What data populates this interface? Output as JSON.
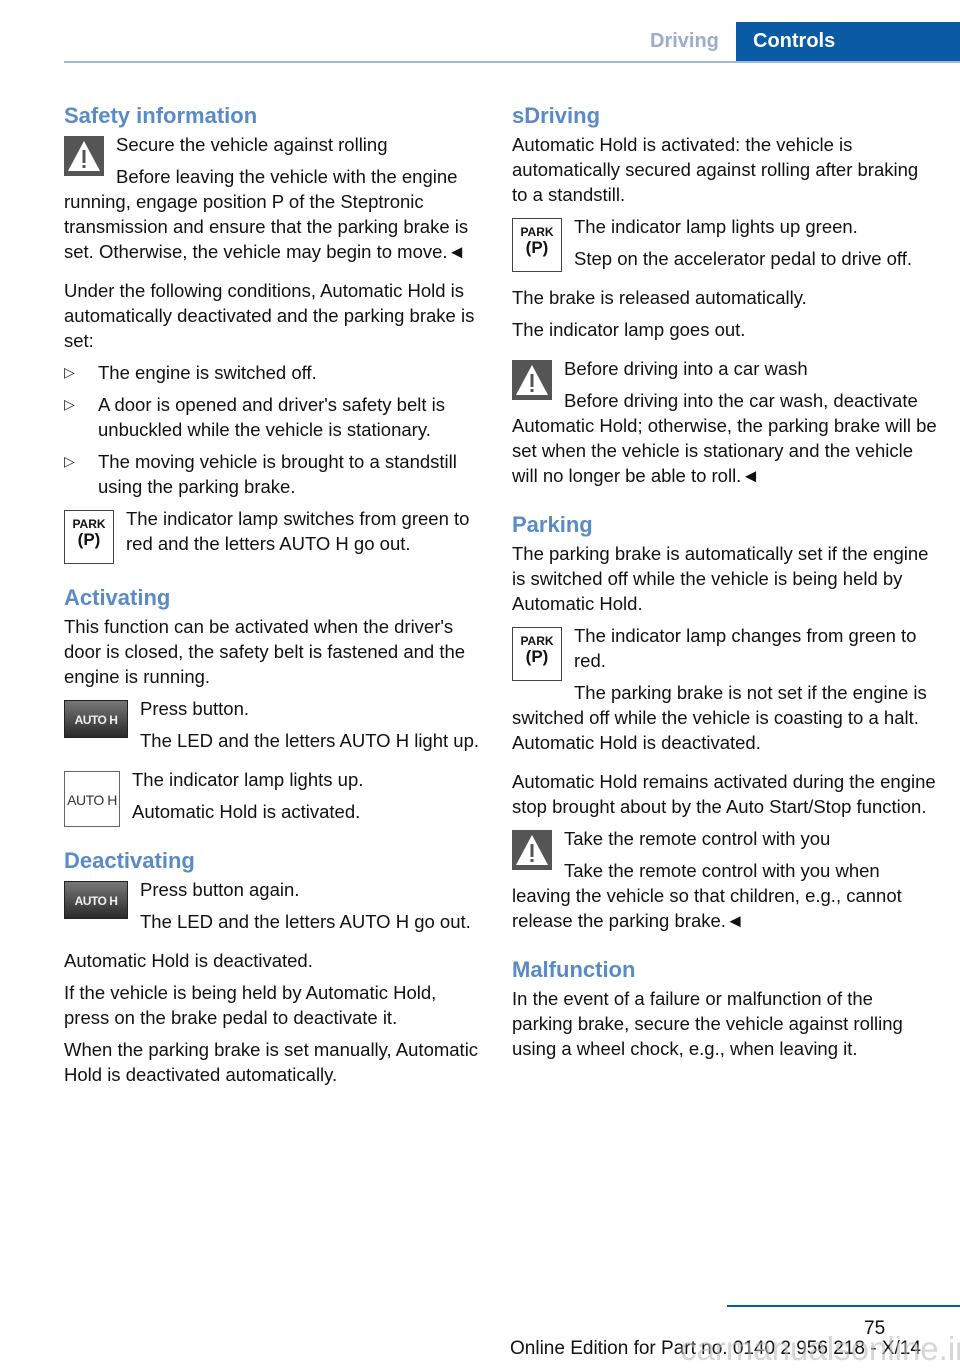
{
  "header": {
    "tab_driving": "Driving",
    "tab_controls": "Controls"
  },
  "left": {
    "safety_heading": "Safety information",
    "safety_title": "Secure the vehicle against rolling",
    "safety_text": "Before leaving the vehicle with the engine running, engage position P of the Steptronic transmission and ensure that the parking brake is set. Otherwise, the vehicle may begin to move.◄",
    "conditions_intro": "Under the following conditions, Automatic Hold is automatically deactivated and the parking brake is set:",
    "conditions": [
      "The engine is switched off.",
      "A door is opened and driver's safety belt is unbuckled while the vehicle is stationary.",
      "The moving vehicle is brought to a standstill using the parking brake."
    ],
    "park_lamp_text": "The indicator lamp switches from green to red and the letters AUTO H go out.",
    "activating_heading": "Activating",
    "activating_intro": "This function can be activated when the driver's door is closed, the safety belt is fastened and the engine is running.",
    "press_button": "Press button.",
    "led_light_up": "The LED and the letters AUTO H light up.",
    "lamp_lights_up": "The indicator lamp lights up.",
    "hold_activated": "Automatic Hold is activated.",
    "deactivating_heading": "Deactivating",
    "press_again": "Press button again.",
    "led_go_out": "The LED and the letters AUTO H go out.",
    "hold_deactivated": "Automatic Hold is deactivated.",
    "brake_pedal": "If the vehicle is being held by Automatic Hold, press on the brake pedal to deactivate it.",
    "manual_set": "When the parking brake is set manually, Automatic Hold is deactivated automatically."
  },
  "right": {
    "sdriving_heading": "sDriving",
    "sdriving_intro": "Automatic Hold is activated: the vehicle is automatically secured against rolling after braking to a standstill.",
    "lamp_green": "The indicator lamp lights up green.",
    "accel_drive": "Step on the accelerator pedal to drive off.",
    "brake_released": "The brake is released automatically.",
    "lamp_out": "The indicator lamp goes out.",
    "carwash_title": "Before driving into a car wash",
    "carwash_text": "Before driving into the car wash, deactivate Automatic Hold; otherwise, the parking brake will be set when the vehicle is stationary and the vehicle will no longer be able to roll.◄",
    "parking_heading": "Parking",
    "parking_intro": "The parking brake is automatically set if the engine is switched off while the vehicle is being held by Automatic Hold.",
    "lamp_green_red": "The indicator lamp changes from green to red.",
    "coasting": "The parking brake is not set if the engine is switched off while the vehicle is coasting to a halt. Automatic Hold is deactivated.",
    "auto_start": "Automatic Hold remains activated during the engine stop brought about by the Auto Start/Stop function.",
    "remote_title": "Take the remote control with you",
    "remote_text": "Take the remote control with you when leaving the vehicle so that children, e.g., cannot release the parking brake.◄",
    "malfunction_heading": "Malfunction",
    "malfunction_text": "In the event of a failure or malfunction of the parking brake, secure the vehicle against rolling using a wheel chock, e.g., when leaving it."
  },
  "icons": {
    "park_label": "PARK",
    "park_symbol": "(P)",
    "autoh_label": "AUTO H"
  },
  "footer": {
    "page_number": "75",
    "edition": "Online Edition for Part no. 0140 2 956 218 - X/14",
    "watermark": "carmanualsonline.info"
  }
}
